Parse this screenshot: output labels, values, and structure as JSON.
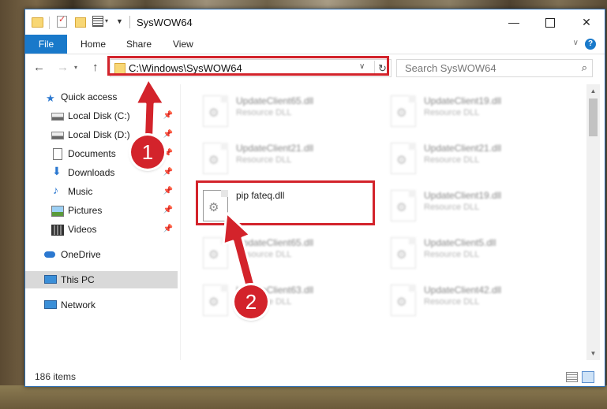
{
  "window": {
    "title": "SysWOW64",
    "controls": {
      "minimize": "—",
      "maximize": "",
      "close": "✕"
    }
  },
  "ribbon": {
    "tabs": [
      "File",
      "Home",
      "Share",
      "View"
    ],
    "help": "?"
  },
  "navigation": {
    "address": "C:\\Windows\\SysWOW64",
    "search_placeholder": "Search SysWOW64"
  },
  "sidebar": {
    "items": [
      {
        "label": "Quick access",
        "icon": "star-icon"
      },
      {
        "label": "Local Disk (C:)",
        "icon": "disk-icon",
        "pinned": true
      },
      {
        "label": "Local Disk (D:)",
        "icon": "disk-icon",
        "pinned": true
      },
      {
        "label": "Documents",
        "icon": "documents-icon",
        "pinned": true
      },
      {
        "label": "Downloads",
        "icon": "downloads-icon",
        "pinned": true
      },
      {
        "label": "Music",
        "icon": "music-icon",
        "pinned": true
      },
      {
        "label": "Pictures",
        "icon": "pictures-icon",
        "pinned": true
      },
      {
        "label": "Videos",
        "icon": "videos-icon",
        "pinned": true
      },
      {
        "label": "OneDrive",
        "icon": "onedrive-icon"
      },
      {
        "label": "This PC",
        "icon": "this-pc-icon",
        "selected": true
      },
      {
        "label": "Network",
        "icon": "network-icon"
      }
    ]
  },
  "files": {
    "left": [
      {
        "name": "UpdateClient65.dll",
        "type": "Resource DLL"
      },
      {
        "name": "UpdateClient21.dll",
        "type": "Resource DLL"
      },
      {
        "name": "pip fateq.dll",
        "type": ""
      },
      {
        "name": "UpdateClient65.dll",
        "type": "Resource DLL"
      },
      {
        "name": "UpdateClient63.dll",
        "type": "Resource DLL"
      }
    ],
    "right": [
      {
        "name": "UpdateClient19.dll",
        "type": "Resource DLL"
      },
      {
        "name": "UpdateClient21.dll",
        "type": "Resource DLL"
      },
      {
        "name": "UpdateClient19.dll",
        "type": "Resource DLL"
      },
      {
        "name": "UpdateClient5.dll",
        "type": "Resource DLL"
      },
      {
        "name": "UpdateClient42.dll",
        "type": "Resource DLL"
      }
    ]
  },
  "status": {
    "item_count": "186 items"
  },
  "callouts": {
    "step1": "1",
    "step2": "2"
  },
  "colors": {
    "accent": "#1979ca",
    "callout": "#d3232b",
    "selected": "#d9d9d9"
  }
}
